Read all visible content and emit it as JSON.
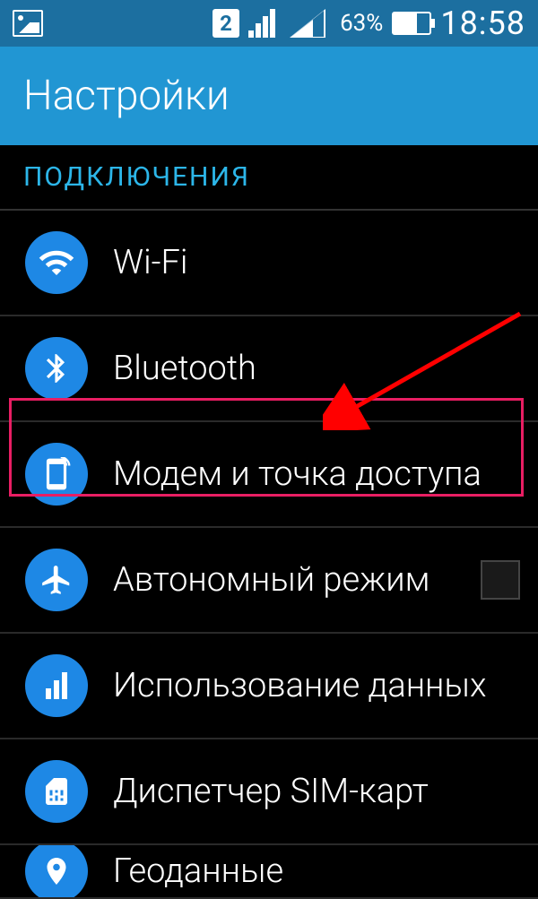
{
  "status": {
    "sim": "2",
    "battery_pct": "63%",
    "time": "18:58"
  },
  "header": {
    "title": "Настройки"
  },
  "section": {
    "label": "ПОДКЛЮЧЕНИЯ"
  },
  "items": [
    {
      "icon": "wifi-icon",
      "label": "Wi-Fi"
    },
    {
      "icon": "bluetooth-icon",
      "label": "Bluetooth"
    },
    {
      "icon": "hotspot-icon",
      "label": "Модем и точка доступа"
    },
    {
      "icon": "airplane-icon",
      "label": "Автономный режим"
    },
    {
      "icon": "data-usage-icon",
      "label": "Использование данных"
    },
    {
      "icon": "sim-icon",
      "label": "Диспетчер SIM-карт"
    },
    {
      "icon": "location-icon",
      "label": "Геоданные"
    }
  ]
}
